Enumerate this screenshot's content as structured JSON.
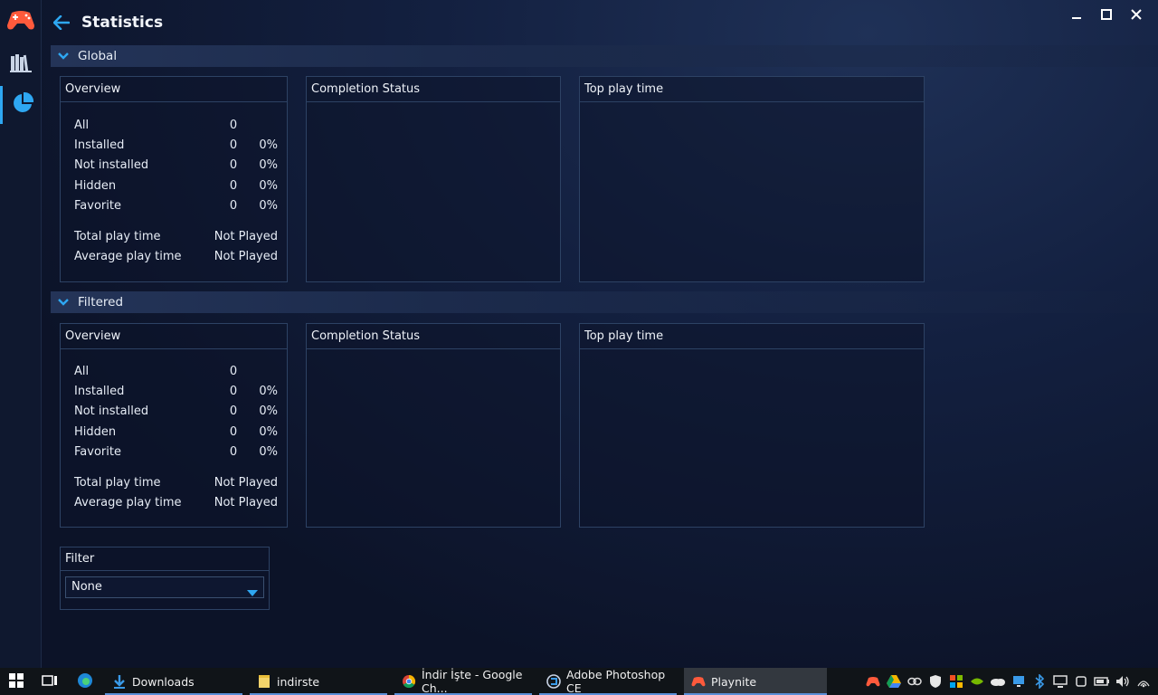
{
  "header": {
    "title": "Statistics"
  },
  "sections": {
    "global": {
      "label": "Global"
    },
    "filtered": {
      "label": "Filtered"
    }
  },
  "overview": {
    "title": "Overview",
    "rows": [
      {
        "label": "All",
        "count": "0",
        "percent": ""
      },
      {
        "label": "Installed",
        "count": "0",
        "percent": "0%"
      },
      {
        "label": "Not installed",
        "count": "0",
        "percent": "0%"
      },
      {
        "label": "Hidden",
        "count": "0",
        "percent": "0%"
      },
      {
        "label": "Favorite",
        "count": "0",
        "percent": "0%"
      }
    ],
    "total_play_time_label": "Total play time",
    "total_play_time_value": "Not Played",
    "avg_play_time_label": "Average play time",
    "avg_play_time_value": "Not Played"
  },
  "completion_status": {
    "title": "Completion Status"
  },
  "top_play_time": {
    "title": "Top play time"
  },
  "filter": {
    "title": "Filter",
    "selected": "None"
  },
  "taskbar": {
    "items": [
      {
        "label": "Downloads",
        "icon": "download-icon"
      },
      {
        "label": "indirste",
        "icon": "folder-icon"
      },
      {
        "label": "İndir İşte - Google Ch...",
        "icon": "chrome-icon"
      },
      {
        "label": "Adobe Photoshop CE",
        "icon": "photoshop-icon"
      },
      {
        "label": "Playnite",
        "icon": "gamepad-icon"
      }
    ]
  },
  "colors": {
    "accent": "#2ea7f2",
    "logo": "#ff5a3c",
    "panel_border": "#2d4264"
  }
}
